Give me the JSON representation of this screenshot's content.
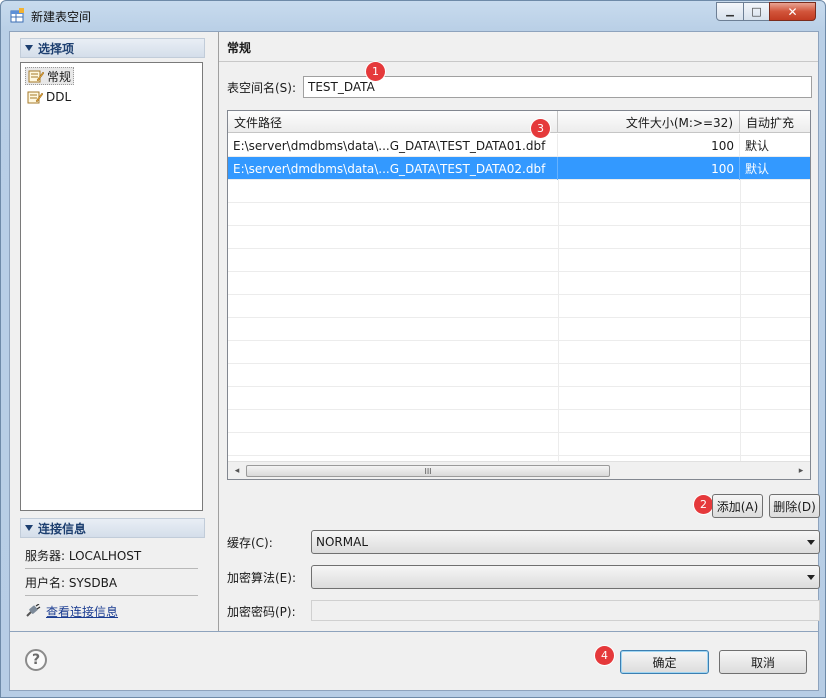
{
  "window": {
    "title": "新建表空间",
    "minimize_glyph": "▁",
    "maximize_glyph": "□",
    "close_glyph": "✕"
  },
  "left": {
    "selection_header": "选择项",
    "tree_items": [
      "常规",
      "DDL"
    ],
    "connection_header": "连接信息",
    "server_label": "服务器: LOCALHOST",
    "user_label": "用户名: SYSDBA",
    "view_link": "查看连接信息"
  },
  "right": {
    "title": "常规",
    "tablespace_name_label": "表空间名(S):",
    "tablespace_name_value": "TEST_DATA",
    "table": {
      "columns": [
        "文件路径",
        "文件大小(M:>=32)",
        "自动扩充"
      ],
      "rows": [
        [
          "E:\\server\\dmdbms\\data\\...G_DATA\\TEST_DATA01.dbf",
          "100",
          "默认"
        ],
        [
          "E:\\server\\dmdbms\\data\\...G_DATA\\TEST_DATA02.dbf",
          "100",
          "默认"
        ]
      ],
      "selected_row": 1,
      "scroll_thumb_glyph": "III",
      "scroll_left_glyph": "◂",
      "scroll_right_glyph": "▸"
    },
    "add_button": "添加(A)",
    "delete_button": "删除(D)",
    "cache_label": "缓存(C):",
    "cache_value": "NORMAL",
    "encrypt_algo_label": "加密算法(E):",
    "encrypt_algo_value": "",
    "encrypt_pwd_label": "加密密码(P):",
    "encrypt_pwd_value": ""
  },
  "footer": {
    "help_glyph": "?",
    "ok_button": "确定",
    "cancel_button": "取消"
  },
  "badges": [
    "1",
    "2",
    "3",
    "4"
  ],
  "colors": {
    "accent_selection": "#3399ff",
    "badge": "#e5393b",
    "link": "#1a3c91",
    "close_button": "#c23b22"
  }
}
